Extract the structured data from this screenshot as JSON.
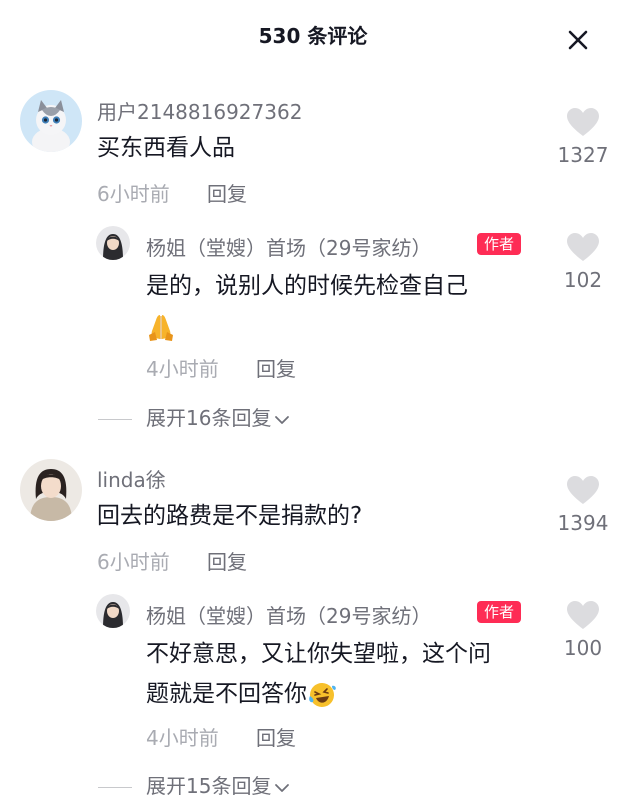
{
  "header": {
    "title": "530 条评论",
    "close_icon": "close-icon"
  },
  "colors": {
    "badge": "#fe2c55",
    "like_icon": "#dcdcdf",
    "meta": "#a9abb2",
    "username": "#6f7079"
  },
  "comments": [
    {
      "username": "用户2148816927362",
      "text": "买东西看人品",
      "time": "6小时前",
      "reply_label": "回复",
      "likes": "1327",
      "reply": {
        "username": "杨姐（堂嫂）首场（29号家纺）",
        "badge": "作者",
        "text_line1": "是的，说别人的时候先检查自己",
        "emoji": "folded-hands-emoji",
        "time": "4小时前",
        "reply_label": "回复",
        "likes": "102"
      },
      "expand_label": "展开16条回复"
    },
    {
      "username": "linda徐",
      "text": "回去的路费是不是捐款的?",
      "time": "6小时前",
      "reply_label": "回复",
      "likes": "1394",
      "reply": {
        "username": "杨姐（堂嫂）首场（29号家纺）",
        "badge": "作者",
        "text_line1": "不好意思，又让你失望啦，这个问",
        "text_line2": "题就是不回答你",
        "emoji": "laughing-tears-emoji",
        "time": "4小时前",
        "reply_label": "回复",
        "likes": "100"
      },
      "expand_label": "展开15条回复"
    }
  ]
}
